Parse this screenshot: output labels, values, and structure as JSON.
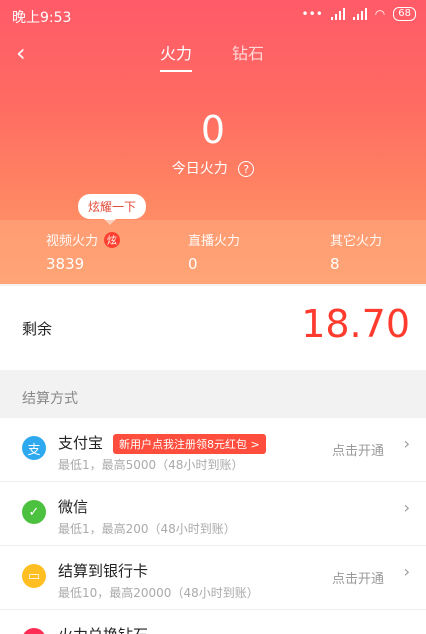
{
  "status_bar": {
    "time": "晚上9:53",
    "battery": "68"
  },
  "nav": {
    "back_icon": "‹",
    "tabs": [
      {
        "label": "火力",
        "active": true
      },
      {
        "label": "钻石",
        "active": false
      }
    ]
  },
  "hero": {
    "today_number": "0",
    "today_label": "今日火力",
    "help_icon": "?",
    "tooltip": "炫耀一下"
  },
  "stats": [
    {
      "label": "视频火力",
      "value": "3839",
      "flame_icon": "炫"
    },
    {
      "label": "直播火力",
      "value": "0"
    },
    {
      "label": "其它火力",
      "value": "8"
    }
  ],
  "balance": {
    "label": "剩余",
    "value": "18.70"
  },
  "settlement": {
    "section_title": "结算方式",
    "methods": [
      {
        "name": "支付宝",
        "badge": "新用户点我注册领8元红包 >",
        "sub": "最低1，最高5000（48小时到账）",
        "right_text": "点击开通",
        "icon_color": "#2ea9ef",
        "icon_glyph": "支"
      },
      {
        "name": "微信",
        "sub": "最低1，最高200（48小时到账）",
        "right_text": "",
        "icon_color": "#4cc13f",
        "icon_glyph": "✓"
      },
      {
        "name": "结算到银行卡",
        "sub": "最低10，最高20000（48小时到账）",
        "right_text": "点击开通",
        "icon_color": "#ffbf23",
        "icon_glyph": "▭"
      },
      {
        "name": "火力兑换钻石",
        "icon_color": "#ff2d55",
        "icon_glyph": "◆"
      }
    ]
  }
}
